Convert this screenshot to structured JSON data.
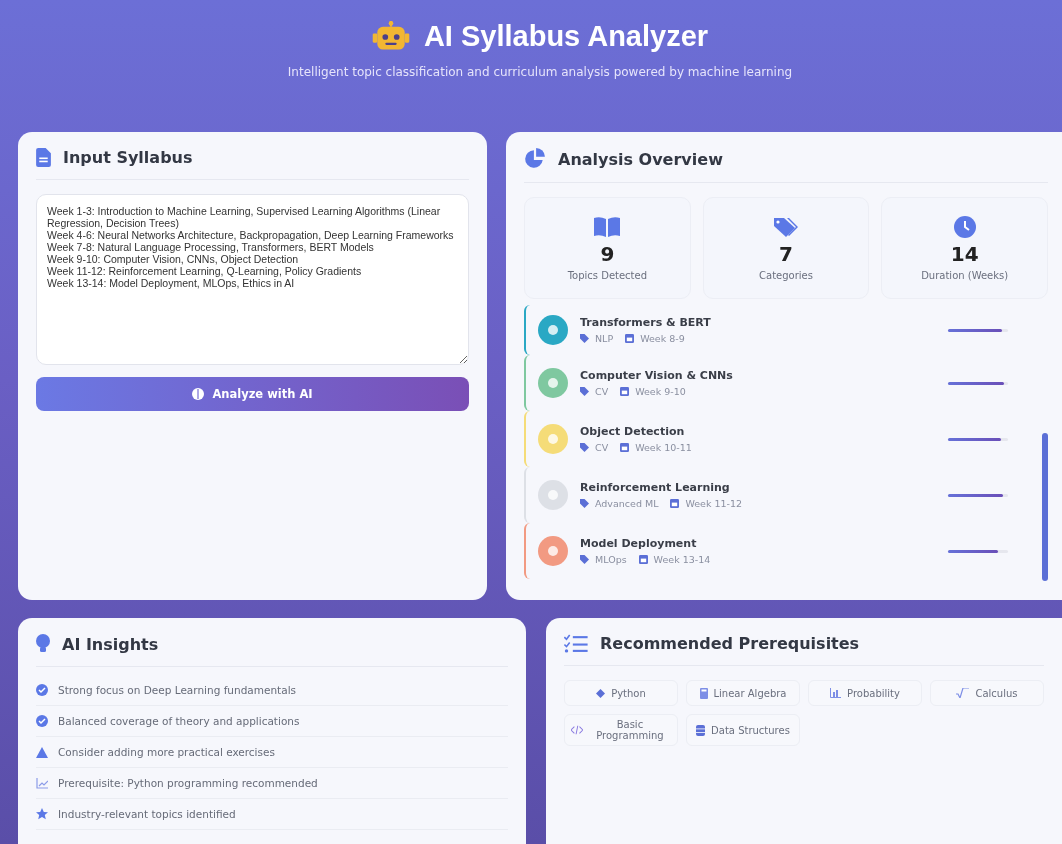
{
  "header": {
    "title": "AI Syllabus Analyzer",
    "subtitle": "Intelligent topic classification and curriculum analysis powered by machine learning"
  },
  "input_panel": {
    "title": "Input Syllabus",
    "syllabus_text": "Week 1-3: Introduction to Machine Learning, Supervised Learning Algorithms (Linear Regression, Decision Trees)\nWeek 4-6: Neural Networks Architecture, Backpropagation, Deep Learning Frameworks\nWeek 7-8: Natural Language Processing, Transformers, BERT Models\nWeek 9-10: Computer Vision, CNNs, Object Detection\nWeek 11-12: Reinforcement Learning, Q-Learning, Policy Gradients\nWeek 13-14: Model Deployment, MLOps, Ethics in AI",
    "button": "Analyze with AI"
  },
  "overview": {
    "title": "Analysis Overview",
    "stats": [
      {
        "kind": "book",
        "value": "9",
        "label": "Topics Detected"
      },
      {
        "kind": "tags",
        "value": "7",
        "label": "Categories"
      },
      {
        "kind": "clock",
        "value": "14",
        "label": "Duration (Weeks)"
      }
    ],
    "topics": [
      {
        "name": "Transformers & BERT",
        "category": "NLP",
        "week": "Week 8-9",
        "color": "#2aa8c4",
        "level": 0.9
      },
      {
        "name": "Computer Vision & CNNs",
        "category": "CV",
        "week": "Week 9-10",
        "color": "#7fc8a0",
        "level": 0.93
      },
      {
        "name": "Object Detection",
        "category": "CV",
        "week": "Week 10-11",
        "color": "#f5dc78",
        "level": 0.88
      },
      {
        "name": "Reinforcement Learning",
        "category": "Advanced ML",
        "week": "Week 11-12",
        "color": "#dde0e6",
        "level": 0.92
      },
      {
        "name": "Model Deployment",
        "category": "MLOps",
        "week": "Week 13-14",
        "color": "#f29a82",
        "level": 0.83
      }
    ]
  },
  "insights": {
    "title": "AI Insights",
    "items": [
      {
        "kind": "check",
        "text": "Strong focus on Deep Learning fundamentals"
      },
      {
        "kind": "check",
        "text": "Balanced coverage of theory and applications"
      },
      {
        "kind": "warning",
        "text": "Consider adding more practical exercises"
      },
      {
        "kind": "chart",
        "text": "Prerequisite: Python programming recommended"
      },
      {
        "kind": "star",
        "text": "Industry-relevant topics identified"
      }
    ]
  },
  "prerequisites": {
    "title": "Recommended Prerequisites",
    "items": [
      {
        "kind": "diamond",
        "label": "Python"
      },
      {
        "kind": "calculator",
        "label": "Linear Algebra"
      },
      {
        "kind": "chart",
        "label": "Probability"
      },
      {
        "kind": "root",
        "label": "Calculus"
      },
      {
        "kind": "code",
        "label": "Basic Programming"
      },
      {
        "kind": "database",
        "label": "Data Structures"
      }
    ]
  }
}
